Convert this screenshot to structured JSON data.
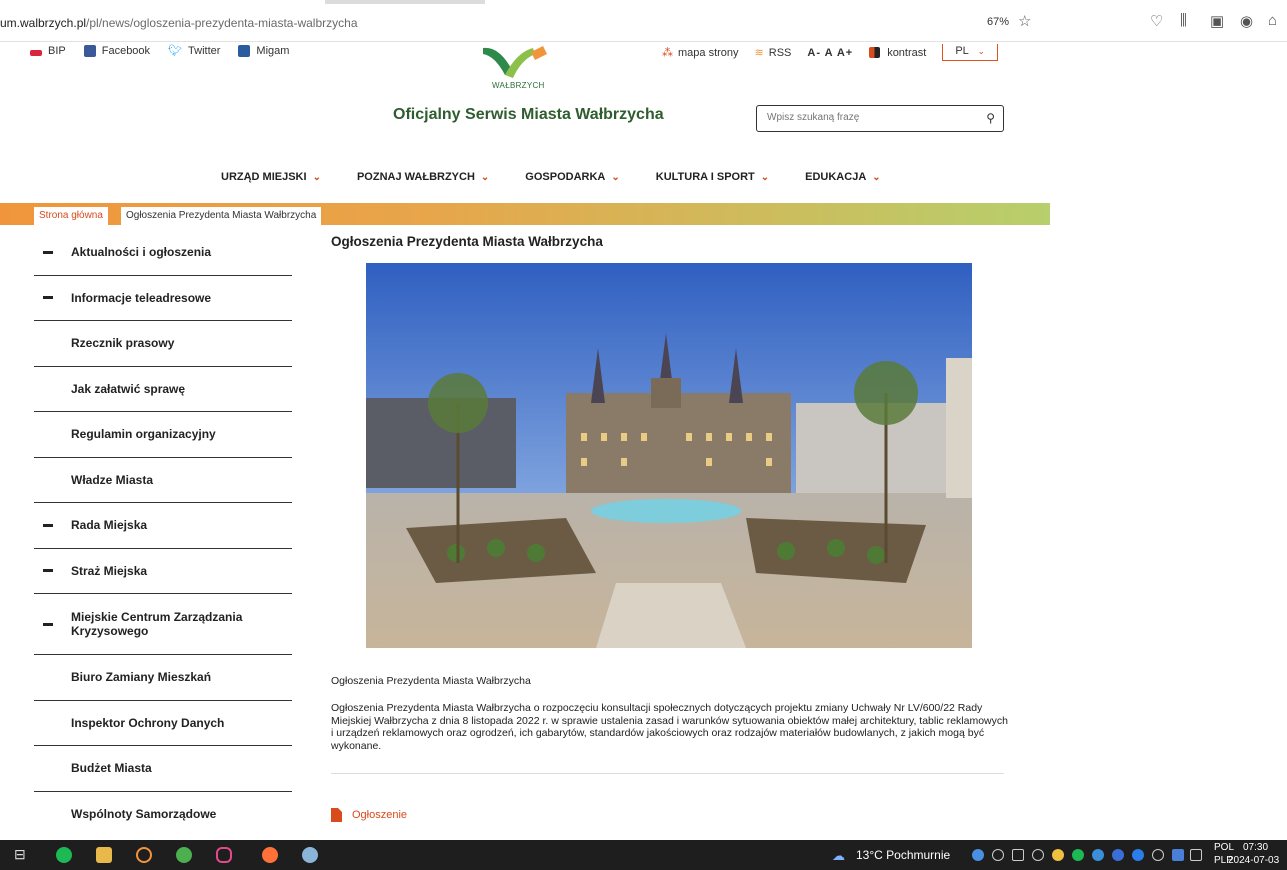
{
  "browser": {
    "url_domain": "um.walbrzych.pl",
    "url_path": "/pl/news/ogloszenia-prezydenta-miasta-walbrzycha",
    "zoom": "67%"
  },
  "topbar": {
    "left_links": [
      "BIP",
      "Facebook",
      "Twitter",
      "Migam"
    ],
    "right_links": {
      "sitemap": "mapa strony",
      "rss": "RSS",
      "font_sizes": "A- A A+",
      "contrast": "kontrast",
      "lang": "PL"
    }
  },
  "header": {
    "logo_text": "WAŁBRZYCH",
    "title": "Oficjalny Serwis Miasta Wałbrzycha",
    "search_placeholder": "Wpisz szukaną frazę"
  },
  "nav": [
    "URZĄD MIEJSKI",
    "POZNAJ WAŁBRZYCH",
    "GOSPODARKA",
    "KULTURA I SPORT",
    "EDUKACJA"
  ],
  "breadcrumb": {
    "home": "Strona główna",
    "current": "Ogłoszenia Prezydenta Miasta Wałbrzycha"
  },
  "sidebar": [
    {
      "label": "Aktualności i ogłoszenia",
      "expanded": true
    },
    {
      "label": "Informacje teleadresowe",
      "expanded": true
    },
    {
      "label": "Rzecznik prasowy",
      "expanded": false
    },
    {
      "label": "Jak załatwić sprawę",
      "expanded": false
    },
    {
      "label": "Regulamin organizacyjny",
      "expanded": false
    },
    {
      "label": "Władze Miasta",
      "expanded": false
    },
    {
      "label": "Rada Miejska",
      "expanded": true
    },
    {
      "label": "Straż Miejska",
      "expanded": true
    },
    {
      "label": "Miejskie Centrum Zarządzania Kryzysowego",
      "expanded": true
    },
    {
      "label": "Biuro Zamiany Mieszkań",
      "expanded": false
    },
    {
      "label": "Inspektor Ochrony Danych",
      "expanded": false
    },
    {
      "label": "Budżet Miasta",
      "expanded": false
    },
    {
      "label": "Wspólnoty Samorządowe",
      "expanded": false
    }
  ],
  "content": {
    "title": "Ogłoszenia Prezydenta Miasta Wałbrzycha",
    "subtitle": "Ogłoszenia Prezydenta Miasta Wałbrzycha",
    "body": "Ogłoszenia Prezydenta Miasta Wałbrzycha o rozpoczęciu konsultacji społecznych dotyczących projektu zmiany Uchwały Nr LV/600/22 Rady Miejskiej Wałbrzycha z dnia 8 listopada 2022 r. w sprawie ustalenia zasad i warunków sytuowania obiektów małej architektury, tablic reklamowych i urządzeń reklamowych oraz ogrodzeń, ich gabarytów, standardów jakościowych oraz rodzajów materiałów budowlanych, z jakich mogą być wykonane.",
    "attachment": "Ogłoszenie"
  },
  "taskbar": {
    "weather": "13°C Pochmurnie",
    "lang": "POL",
    "layout": "PLP",
    "time": "07:30",
    "date": "2024-07-03"
  },
  "colors": {
    "accent": "#d74b1c",
    "title_green": "#2f5d2f"
  }
}
